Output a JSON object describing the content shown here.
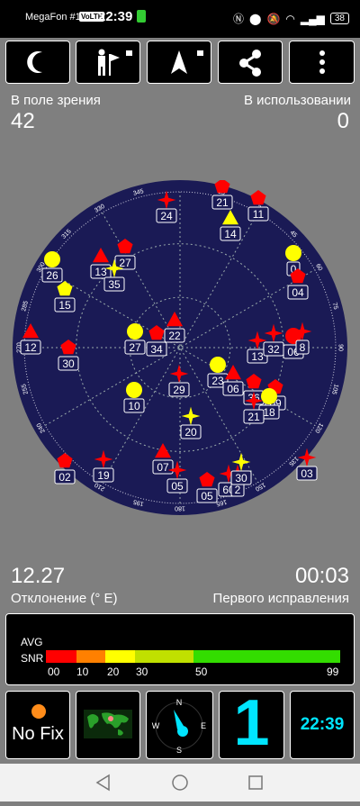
{
  "status_bar": {
    "carrier": "MegaFon #1",
    "volte": "VoLTE",
    "time": "22:39",
    "battery": "38"
  },
  "toolbar": [
    {
      "name": "night-mode-button",
      "icon": "moon-icon"
    },
    {
      "name": "map-marker-lock-button",
      "icon": "person-flag-lock-icon"
    },
    {
      "name": "north-lock-button",
      "icon": "arrow-lock-icon"
    },
    {
      "name": "share-button",
      "icon": "share-icon"
    },
    {
      "name": "menu-button",
      "icon": "more-vert-icon"
    }
  ],
  "info": {
    "in_view_label": "В поле зрения",
    "in_view_value": "42",
    "in_use_label": "В использовании",
    "in_use_value": "0",
    "declination_value": "12.27",
    "declination_label": "Отклонение (° E)",
    "ttff_value": "00:03",
    "ttff_label": "Первого исправления"
  },
  "sky": {
    "ticks": [
      "330",
      "345",
      "15",
      "30",
      "45",
      "60",
      "75",
      "90",
      "105",
      "120",
      "135",
      "150",
      "165",
      "180",
      "195",
      "210",
      "225",
      "240",
      "255",
      "270",
      "285",
      "300",
      "315"
    ],
    "satellites": [
      {
        "id": "21",
        "shape": "pentagon",
        "color": "#ff0000"
      },
      {
        "id": "11",
        "shape": "pentagon",
        "color": "#ff0000"
      },
      {
        "id": "24",
        "shape": "star",
        "color": "#ff0000"
      },
      {
        "id": "14",
        "shape": "triangle",
        "color": "#ffff00"
      },
      {
        "id": "27",
        "shape": "pentagon",
        "color": "#ff0000"
      },
      {
        "id": "13",
        "shape": "triangle",
        "color": "#ff0000"
      },
      {
        "id": "26",
        "shape": "circle",
        "color": "#ffff00"
      },
      {
        "id": "35",
        "shape": "star",
        "color": "#ffff00"
      },
      {
        "id": "15",
        "shape": "pentagon",
        "color": "#ffff00"
      },
      {
        "id": "0",
        "shape": "circle",
        "color": "#ffff00"
      },
      {
        "id": "04",
        "shape": "pentagon",
        "color": "#ff0000"
      },
      {
        "id": "12",
        "shape": "triangle",
        "color": "#ff0000"
      },
      {
        "id": "30",
        "shape": "pentagon",
        "color": "#ff0000"
      },
      {
        "id": "27",
        "shape": "circle",
        "color": "#ffff00"
      },
      {
        "id": "34",
        "shape": "pentagon",
        "color": "#ff0000"
      },
      {
        "id": "22",
        "shape": "triangle",
        "color": "#ff0000"
      },
      {
        "id": "13",
        "shape": "star",
        "color": "#ff0000"
      },
      {
        "id": "32",
        "shape": "star",
        "color": "#ff0000"
      },
      {
        "id": "06",
        "shape": "circle",
        "color": "#ff0000"
      },
      {
        "id": "8",
        "shape": "star",
        "color": "#ff0000"
      },
      {
        "id": "29",
        "shape": "star",
        "color": "#ff0000"
      },
      {
        "id": "23",
        "shape": "circle",
        "color": "#ffff00"
      },
      {
        "id": "06",
        "shape": "triangle",
        "color": "#ff0000"
      },
      {
        "id": "36",
        "shape": "pentagon",
        "color": "#ff0000"
      },
      {
        "id": "09",
        "shape": "pentagon",
        "color": "#ff0000"
      },
      {
        "id": "18",
        "shape": "circle",
        "color": "#ffff00"
      },
      {
        "id": "21",
        "shape": "star",
        "color": "#ff0000"
      },
      {
        "id": "10",
        "shape": "circle",
        "color": "#ffff00"
      },
      {
        "id": "20",
        "shape": "star",
        "color": "#ffff00"
      },
      {
        "id": "03",
        "shape": "star",
        "color": "#ff0000"
      },
      {
        "id": "02",
        "shape": "pentagon",
        "color": "#ff0000"
      },
      {
        "id": "19",
        "shape": "star",
        "color": "#ff0000"
      },
      {
        "id": "07",
        "shape": "triangle",
        "color": "#ff0000"
      },
      {
        "id": "05",
        "shape": "star",
        "color": "#ff0000"
      },
      {
        "id": "05",
        "shape": "pentagon",
        "color": "#ff0000"
      },
      {
        "id": "60",
        "shape": "star",
        "color": "#ff0000"
      },
      {
        "id": "2",
        "shape": "star",
        "color": "#ff0000"
      },
      {
        "id": "30",
        "shape": "star",
        "color": "#ffff00"
      }
    ]
  },
  "snr": {
    "avg_label": "AVG",
    "snr_label": "SNR",
    "scale": [
      "00",
      "10",
      "20",
      "30",
      "50",
      "99"
    ]
  },
  "bottom": {
    "no_fix": "No Fix",
    "sat_count": "1",
    "clock": "22:39",
    "compass": [
      "N",
      "E",
      "S",
      "W"
    ]
  },
  "colors": {
    "red": "#ff0000",
    "yellow": "#ffff00",
    "orange": "#ff8000",
    "yellowgreen": "#c0e000",
    "green": "#33dd00",
    "sky": "#1a1a55",
    "accent": "#00e5ff"
  }
}
